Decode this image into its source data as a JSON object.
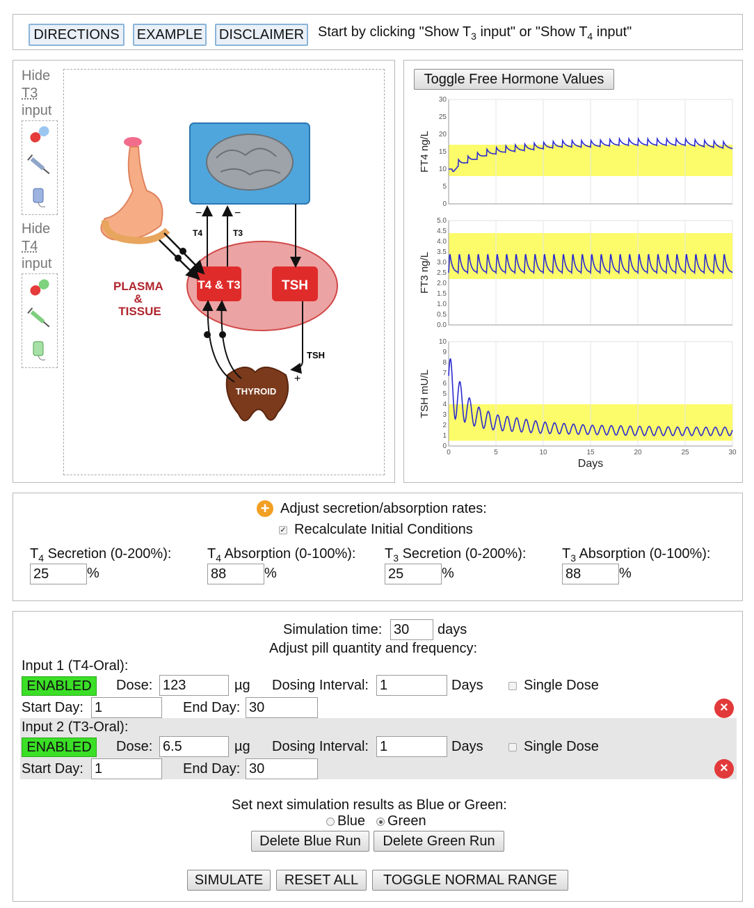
{
  "toolbar": {
    "directions": "DIRECTIONS",
    "example": "EXAMPLE",
    "disclaimer": "DISCLAIMER",
    "hint_prefix": "Start by clicking \"Show T",
    "hint_sub1": "3",
    "hint_mid": " input\" or \"Show T",
    "hint_sub2": "4",
    "hint_suffix": " input\""
  },
  "diagram": {
    "t3_toggle": [
      "Hide",
      "T3",
      "input"
    ],
    "t4_toggle": [
      "Hide",
      "T4",
      "input"
    ],
    "plasma_label": [
      "PLASMA",
      "&",
      "TISSUE"
    ],
    "t4t3_label": "T4 & T3",
    "tsh_label": "TSH",
    "thyroid_label": "THYROID",
    "arrow_t4": "T4",
    "arrow_t3": "T3",
    "arrow_tsh": "TSH",
    "minus": "−",
    "plus": "+"
  },
  "charts": {
    "toggle_label": "Toggle Free Hormone Values",
    "xlabel": "Days"
  },
  "chart_data": [
    {
      "type": "line",
      "ylabel": "FT4 ng/L",
      "ylim": [
        0,
        30
      ],
      "yticks": [
        "0",
        "5",
        "10",
        "15",
        "20",
        "25",
        "30"
      ],
      "xlim": [
        0,
        30
      ],
      "normal_range": [
        8,
        17
      ],
      "series": [
        {
          "color": "#2a2ad0",
          "x": [
            0,
            0.5,
            1,
            2,
            3,
            4,
            5,
            6,
            8,
            10,
            12,
            15,
            18,
            20,
            25,
            30
          ],
          "values": [
            10,
            10,
            12,
            13,
            14,
            15,
            15.5,
            16,
            16.5,
            17,
            17.5,
            17.5,
            18,
            18,
            18,
            17
          ]
        }
      ]
    },
    {
      "type": "line",
      "ylabel": "FT3 ng/L",
      "ylim": [
        0,
        5
      ],
      "yticks": [
        "0.0",
        "0.5",
        "1.0",
        "1.5",
        "2.0",
        "2.5",
        "3.0",
        "3.5",
        "4.0",
        "4.5",
        "5.0"
      ],
      "xlim": [
        0,
        30
      ],
      "normal_range": [
        2.2,
        4.4
      ],
      "series": [
        {
          "color": "#2a2ad0",
          "x": [
            0,
            30
          ],
          "peak": 3.5,
          "trough": 2.5
        }
      ]
    },
    {
      "type": "line",
      "ylabel": "TSH mU/L",
      "ylim": [
        0,
        10
      ],
      "yticks": [
        "0",
        "1",
        "2",
        "3",
        "4",
        "5",
        "6",
        "7",
        "8",
        "9",
        "10"
      ],
      "xlabel": "Days",
      "xlim": [
        0,
        30
      ],
      "xticks": [
        "0",
        "5",
        "10",
        "15",
        "20",
        "25",
        "30"
      ],
      "normal_range": [
        0.5,
        4
      ],
      "series": [
        {
          "color": "#2a2ad0",
          "x": [
            0,
            1,
            2,
            3,
            5,
            10,
            15,
            20,
            25,
            30
          ],
          "peak": [
            8.8,
            6.5,
            4.8,
            3.8,
            3,
            2.3,
            2,
            1.9,
            1.8,
            1.8
          ],
          "trough": [
            2.8,
            2.5,
            2.2,
            1.8,
            1.5,
            1.2,
            1.1,
            1,
            1,
            1
          ]
        }
      ]
    }
  ],
  "adjust": {
    "title": "Adjust secretion/absorption rates:",
    "recalc": "Recalculate Initial Conditions",
    "fields": [
      {
        "pre": "T",
        "sub": "4",
        "post": " Secretion (0-200%):",
        "value": "25",
        "unit": "%"
      },
      {
        "pre": "T",
        "sub": "4",
        "post": " Absorption (0-100%):",
        "value": "88",
        "unit": "%"
      },
      {
        "pre": "T",
        "sub": "3",
        "post": " Secretion (0-200%):",
        "value": "25",
        "unit": "%"
      },
      {
        "pre": "T",
        "sub": "3",
        "post": " Absorption (0-100%):",
        "value": "88",
        "unit": "%"
      }
    ]
  },
  "sim": {
    "time_label": "Simulation time:",
    "time_value": "30",
    "time_unit": "days",
    "adjust_label": "Adjust pill quantity and frequency:",
    "inputs": [
      {
        "title": "Input 1 (T4-Oral):",
        "status": "ENABLED",
        "dose_label": "Dose:",
        "dose": "123",
        "dose_unit": "µg",
        "interval_label": "Dosing Interval:",
        "interval": "1",
        "interval_unit": "Days",
        "single": "Single Dose",
        "start_label": "Start Day:",
        "start": "1",
        "end_label": "End Day:",
        "end": "30"
      },
      {
        "title": "Input 2 (T3-Oral):",
        "status": "ENABLED",
        "dose_label": "Dose:",
        "dose": "6.5",
        "dose_unit": "µg",
        "interval_label": "Dosing Interval:",
        "interval": "1",
        "interval_unit": "Days",
        "single": "Single Dose",
        "start_label": "Start Day:",
        "start": "1",
        "end_label": "End Day:",
        "end": "30"
      }
    ],
    "color_label": "Set next simulation results as Blue or Green:",
    "blue": "Blue",
    "green": "Green",
    "delete_blue": "Delete Blue Run",
    "delete_green": "Delete Green Run",
    "simulate": "SIMULATE",
    "reset": "RESET ALL",
    "toggle_normal": "TOGGLE NORMAL RANGE"
  }
}
